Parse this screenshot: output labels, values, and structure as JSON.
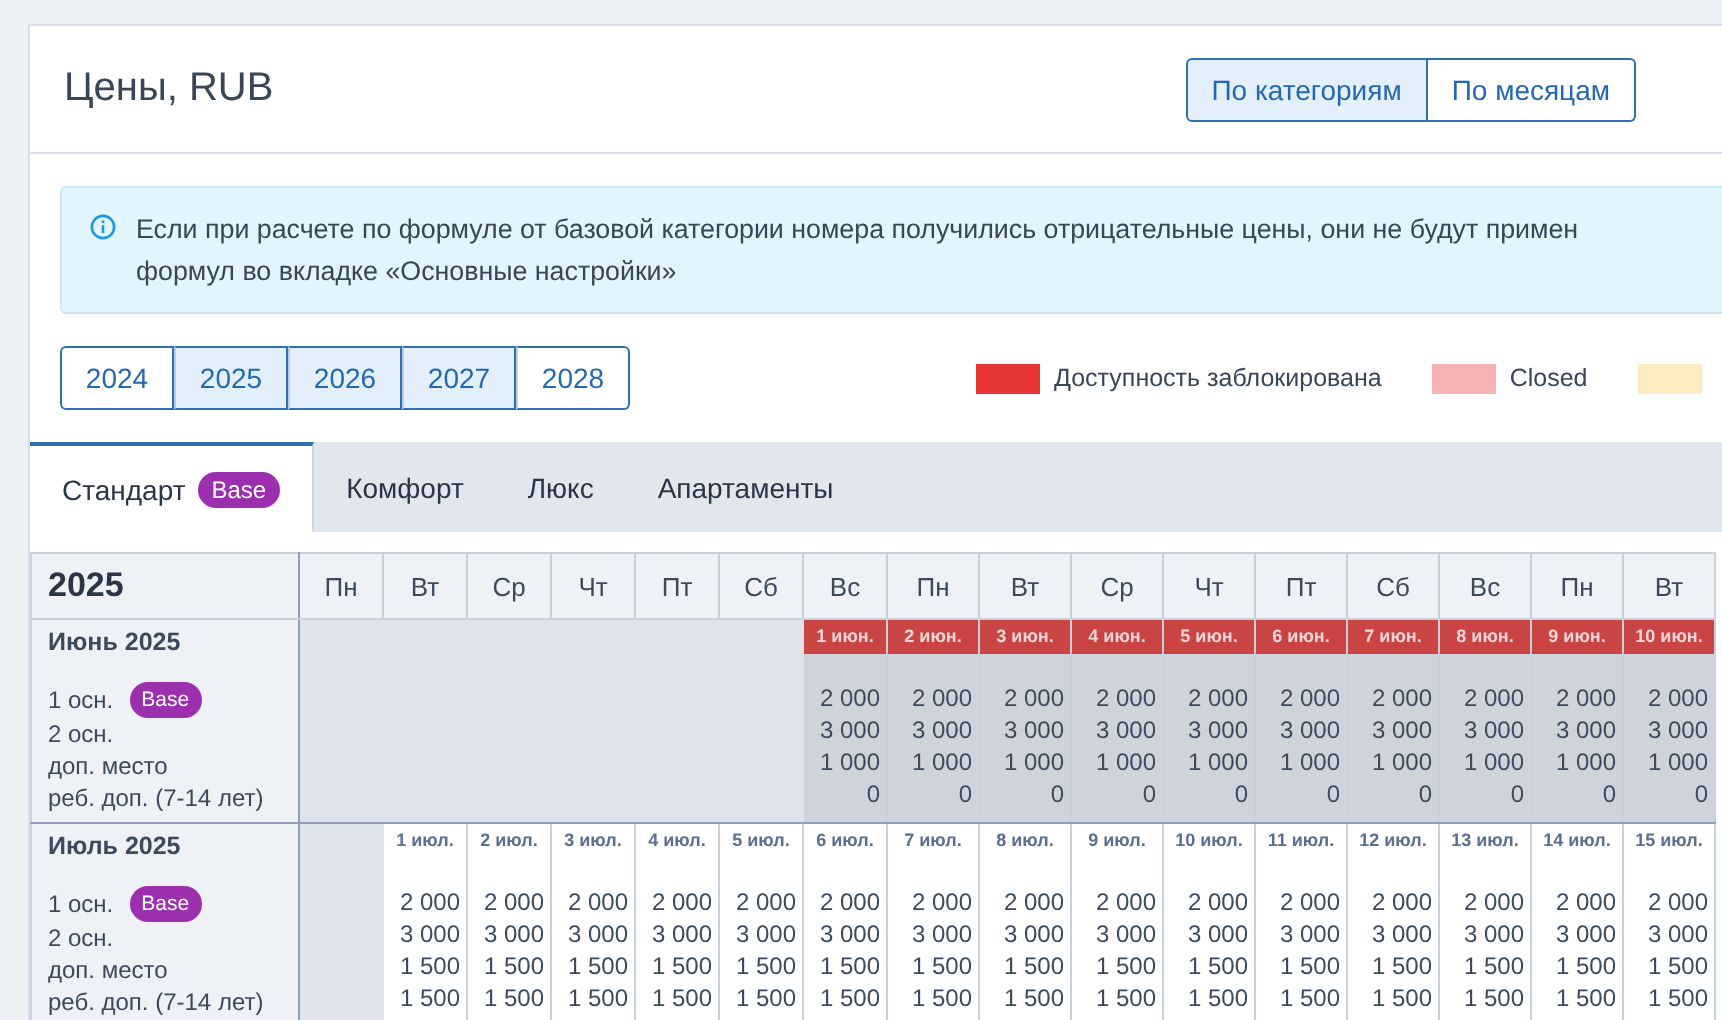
{
  "header": {
    "title": "Цены, RUB",
    "view_toggle": [
      {
        "label": "По категориям",
        "selected": true
      },
      {
        "label": "По месяцам",
        "selected": false
      }
    ]
  },
  "info_alert": {
    "text": "Если при расчете по формуле от базовой категории номера получились отрицательные цены, они не будут примен\nформул во вкладке «Основные настройки»"
  },
  "years": [
    {
      "label": "2024",
      "selected": false
    },
    {
      "label": "2025",
      "selected": true
    },
    {
      "label": "2026",
      "selected": true
    },
    {
      "label": "2027",
      "selected": true
    },
    {
      "label": "2028",
      "selected": false
    }
  ],
  "legend": [
    {
      "label": "Доступность заблокирована",
      "color": "#e53535"
    },
    {
      "label": "Closed",
      "color": "#f7b3b3"
    },
    {
      "color": "#fdecc0"
    }
  ],
  "tabs": [
    {
      "label": "Стандарт",
      "badge": "Base",
      "selected": true
    },
    {
      "label": "Комфорт",
      "selected": false
    },
    {
      "label": "Люкс",
      "selected": false
    },
    {
      "label": "Апартаменты",
      "selected": false
    }
  ],
  "table": {
    "year": "2025",
    "weekdays": [
      "Пн",
      "Вт",
      "Ср",
      "Чт",
      "Пт",
      "Сб",
      "Вс",
      "Пн",
      "Вт",
      "Ср",
      "Чт",
      "Пт",
      "Сб",
      "Вс",
      "Пн",
      "Вт"
    ],
    "months": [
      {
        "label": "Июнь 2025",
        "rows": [
          {
            "label": "1 осн.",
            "badge": "Base"
          },
          {
            "label": "2 осн."
          },
          {
            "label": "доп. место"
          },
          {
            "label": "реб. доп. (7-14 лет)"
          }
        ],
        "days": [
          {
            "kind": "empty"
          },
          {
            "kind": "empty"
          },
          {
            "kind": "empty"
          },
          {
            "kind": "empty"
          },
          {
            "kind": "empty"
          },
          {
            "kind": "empty"
          },
          {
            "kind": "day",
            "date": "1 июн.",
            "blocked": true,
            "values": [
              "2 000",
              "3 000",
              "1 000",
              "0"
            ]
          },
          {
            "kind": "day",
            "date": "2 июн.",
            "blocked": true,
            "values": [
              "2 000",
              "3 000",
              "1 000",
              "0"
            ]
          },
          {
            "kind": "day",
            "date": "3 июн.",
            "blocked": true,
            "values": [
              "2 000",
              "3 000",
              "1 000",
              "0"
            ]
          },
          {
            "kind": "day",
            "date": "4 июн.",
            "blocked": true,
            "values": [
              "2 000",
              "3 000",
              "1 000",
              "0"
            ]
          },
          {
            "kind": "day",
            "date": "5 июн.",
            "blocked": true,
            "values": [
              "2 000",
              "3 000",
              "1 000",
              "0"
            ]
          },
          {
            "kind": "day",
            "date": "6 июн.",
            "blocked": true,
            "values": [
              "2 000",
              "3 000",
              "1 000",
              "0"
            ]
          },
          {
            "kind": "day",
            "date": "7 июн.",
            "blocked": true,
            "values": [
              "2 000",
              "3 000",
              "1 000",
              "0"
            ]
          },
          {
            "kind": "day",
            "date": "8 июн.",
            "blocked": true,
            "values": [
              "2 000",
              "3 000",
              "1 000",
              "0"
            ]
          },
          {
            "kind": "day",
            "date": "9 июн.",
            "blocked": true,
            "values": [
              "2 000",
              "3 000",
              "1 000",
              "0"
            ]
          },
          {
            "kind": "day",
            "date": "10 июн.",
            "blocked": true,
            "values": [
              "2 000",
              "3 000",
              "1 000",
              "0"
            ]
          }
        ]
      },
      {
        "label": "Июль 2025",
        "rows": [
          {
            "label": "1 осн.",
            "badge": "Base"
          },
          {
            "label": "2 осн."
          },
          {
            "label": "доп. место"
          },
          {
            "label": "реб. доп. (7-14 лет)"
          }
        ],
        "days": [
          {
            "kind": "empty"
          },
          {
            "kind": "day",
            "date": "1 июл.",
            "blocked": false,
            "values": [
              "2 000",
              "3 000",
              "1 500",
              "1 500"
            ]
          },
          {
            "kind": "day",
            "date": "2 июл.",
            "blocked": false,
            "values": [
              "2 000",
              "3 000",
              "1 500",
              "1 500"
            ]
          },
          {
            "kind": "day",
            "date": "3 июл.",
            "blocked": false,
            "values": [
              "2 000",
              "3 000",
              "1 500",
              "1 500"
            ]
          },
          {
            "kind": "day",
            "date": "4 июл.",
            "blocked": false,
            "values": [
              "2 000",
              "3 000",
              "1 500",
              "1 500"
            ]
          },
          {
            "kind": "day",
            "date": "5 июл.",
            "blocked": false,
            "values": [
              "2 000",
              "3 000",
              "1 500",
              "1 500"
            ]
          },
          {
            "kind": "day",
            "date": "6 июл.",
            "blocked": false,
            "values": [
              "2 000",
              "3 000",
              "1 500",
              "1 500"
            ]
          },
          {
            "kind": "day",
            "date": "7 июл.",
            "blocked": false,
            "values": [
              "2 000",
              "3 000",
              "1 500",
              "1 500"
            ]
          },
          {
            "kind": "day",
            "date": "8 июл.",
            "blocked": false,
            "values": [
              "2 000",
              "3 000",
              "1 500",
              "1 500"
            ]
          },
          {
            "kind": "day",
            "date": "9 июл.",
            "blocked": false,
            "values": [
              "2 000",
              "3 000",
              "1 500",
              "1 500"
            ]
          },
          {
            "kind": "day",
            "date": "10 июл.",
            "blocked": false,
            "values": [
              "2 000",
              "3 000",
              "1 500",
              "1 500"
            ]
          },
          {
            "kind": "day",
            "date": "11 июл.",
            "blocked": false,
            "values": [
              "2 000",
              "3 000",
              "1 500",
              "1 500"
            ]
          },
          {
            "kind": "day",
            "date": "12 июл.",
            "blocked": false,
            "values": [
              "2 000",
              "3 000",
              "1 500",
              "1 500"
            ]
          },
          {
            "kind": "day",
            "date": "13 июл.",
            "blocked": false,
            "values": [
              "2 000",
              "3 000",
              "1 500",
              "1 500"
            ]
          },
          {
            "kind": "day",
            "date": "14 июл.",
            "blocked": false,
            "values": [
              "2 000",
              "3 000",
              "1 500",
              "1 500"
            ]
          },
          {
            "kind": "day",
            "date": "15 июл.",
            "blocked": false,
            "values": [
              "2 000",
              "3 000",
              "1 500",
              "1 500"
            ]
          }
        ]
      }
    ]
  }
}
